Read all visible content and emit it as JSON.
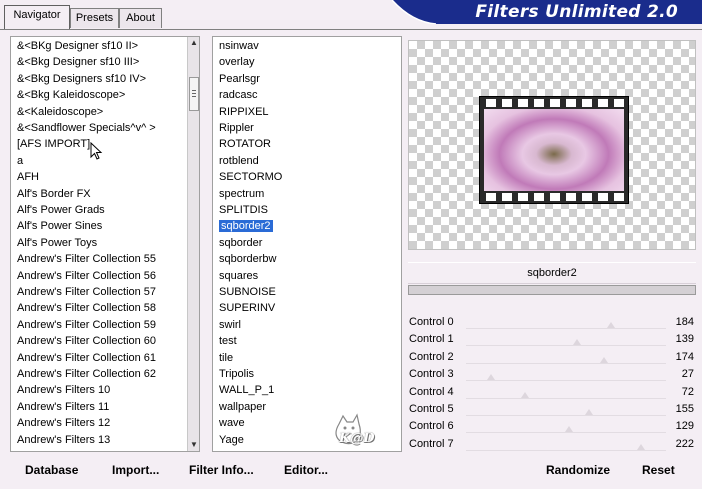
{
  "app": {
    "title": "Filters Unlimited 2.0"
  },
  "tabs": [
    {
      "label": "Navigator",
      "active": true
    },
    {
      "label": "Presets",
      "active": false
    },
    {
      "label": "About",
      "active": false
    }
  ],
  "categories": [
    "&<BKg Designer sf10 II>",
    "&<Bkg Designer sf10 III>",
    "&<Bkg Designers sf10 IV>",
    "&<Bkg Kaleidoscope>",
    "&<Kaleidoscope>",
    "&<Sandflower Specials^v^ >",
    "[AFS IMPORT]",
    "a",
    "AFH",
    "Alf's Border FX",
    "Alf's Power Grads",
    "Alf's Power Sines",
    "Alf's Power Toys",
    "Andrew's Filter Collection 55",
    "Andrew's Filter Collection 56",
    "Andrew's Filter Collection 57",
    "Andrew's Filter Collection 58",
    "Andrew's Filter Collection 59",
    "Andrew's Filter Collection 60",
    "Andrew's Filter Collection 61",
    "Andrew's Filter Collection 62",
    "Andrew's Filters 10",
    "Andrew's Filters 11",
    "Andrew's Filters 12",
    "Andrew's Filters 13"
  ],
  "filters": [
    "nsinwav",
    "overlay",
    "Pearlsgr",
    "radcasc",
    "RIPPIXEL",
    "Rippler",
    "ROTATOR",
    "rotblend",
    "SECTORMO",
    "spectrum",
    "SPLITDIS",
    "sqborder2",
    "sqborder",
    "sqborderbw",
    "squares",
    "SUBNOISE",
    "SUPERINV",
    "swirl",
    "test",
    "tile",
    "Tripolis",
    "WALL_P_1",
    "wallpaper",
    "wave",
    "Yage"
  ],
  "selected_filter_index": 11,
  "preview": {
    "filter_name": "sqborder2"
  },
  "controls": [
    {
      "label": "Control 0",
      "value": "184",
      "level": 184
    },
    {
      "label": "Control 1",
      "value": "139",
      "level": 139
    },
    {
      "label": "Control 2",
      "value": "174",
      "level": 174
    },
    {
      "label": "Control 3",
      "value": "27",
      "level": 27
    },
    {
      "label": "Control 4",
      "value": "72",
      "level": 72
    },
    {
      "label": "Control 5",
      "value": "155",
      "level": 155
    },
    {
      "label": "Control 6",
      "value": "129",
      "level": 129
    },
    {
      "label": "Control 7",
      "value": "222",
      "level": 222
    }
  ],
  "buttons": {
    "database": "Database",
    "import": "Import...",
    "filter_info": "Filter Info...",
    "editor": "Editor...",
    "randomize": "Randomize",
    "reset": "Reset"
  },
  "watermark": {
    "text": "K@D"
  },
  "colors": {
    "banner": "#1a2c8c",
    "selection": "#2a6bd6",
    "accent_pink": "#d8a8d0"
  }
}
